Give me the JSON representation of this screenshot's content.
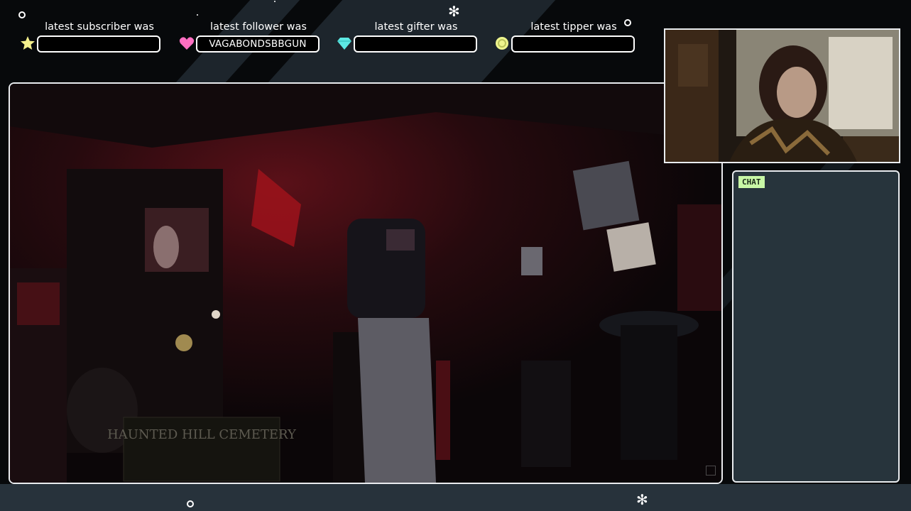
{
  "alerts": [
    {
      "label": "latest subscriber was",
      "value": "",
      "icon": "star-icon",
      "color": "#f4f08c"
    },
    {
      "label": "latest follower was",
      "value": "VAGABONDSBBGUN",
      "icon": "heart-icon",
      "color": "#ff6fc2"
    },
    {
      "label": "latest gifter was",
      "value": "",
      "icon": "diamond-icon",
      "color": "#5de8e3"
    },
    {
      "label": "latest tipper was",
      "value": "",
      "icon": "coin-icon",
      "color": "#eef58e"
    }
  ],
  "chat": {
    "label": "CHAT"
  },
  "scene": {
    "sign_text": "HAUNTED HILL CEMETERY"
  },
  "colors": {
    "background": "#07090b",
    "stripe": "#1d252c",
    "chat_panel": "#27343c",
    "chat_badge": "#c8f7a6",
    "frame_border": "#e9ecef"
  }
}
